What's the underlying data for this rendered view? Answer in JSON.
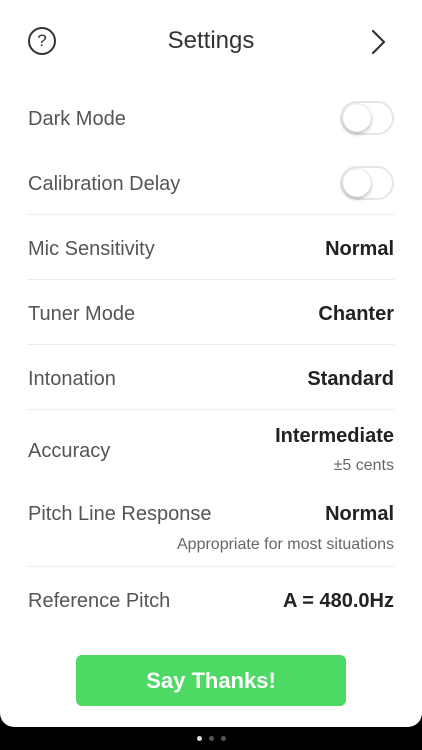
{
  "header": {
    "help_label": "?",
    "title": "Settings",
    "next_icon": "chevron-right-icon"
  },
  "settings": {
    "dark_mode": {
      "label": "Dark Mode",
      "enabled": false
    },
    "calibration_delay": {
      "label": "Calibration Delay",
      "enabled": false
    },
    "mic_sensitivity": {
      "label": "Mic Sensitivity",
      "value": "Normal"
    },
    "tuner_mode": {
      "label": "Tuner Mode",
      "value": "Chanter"
    },
    "intonation": {
      "label": "Intonation",
      "value": "Standard"
    },
    "accuracy": {
      "label": "Accuracy",
      "value": "Intermediate",
      "sub": "±5 cents"
    },
    "pitch_line_response": {
      "label": "Pitch Line Response",
      "value": "Normal",
      "sub": "Appropriate for most situations"
    },
    "reference_pitch": {
      "label": "Reference Pitch",
      "value": "A = 480.0Hz"
    }
  },
  "actions": {
    "say_thanks_label": "Say Thanks!"
  },
  "pager": {
    "count": 3,
    "active_index": 0
  },
  "colors": {
    "accent_green": "#4cd964",
    "text_dark": "#222222",
    "divider": "#ececec"
  }
}
